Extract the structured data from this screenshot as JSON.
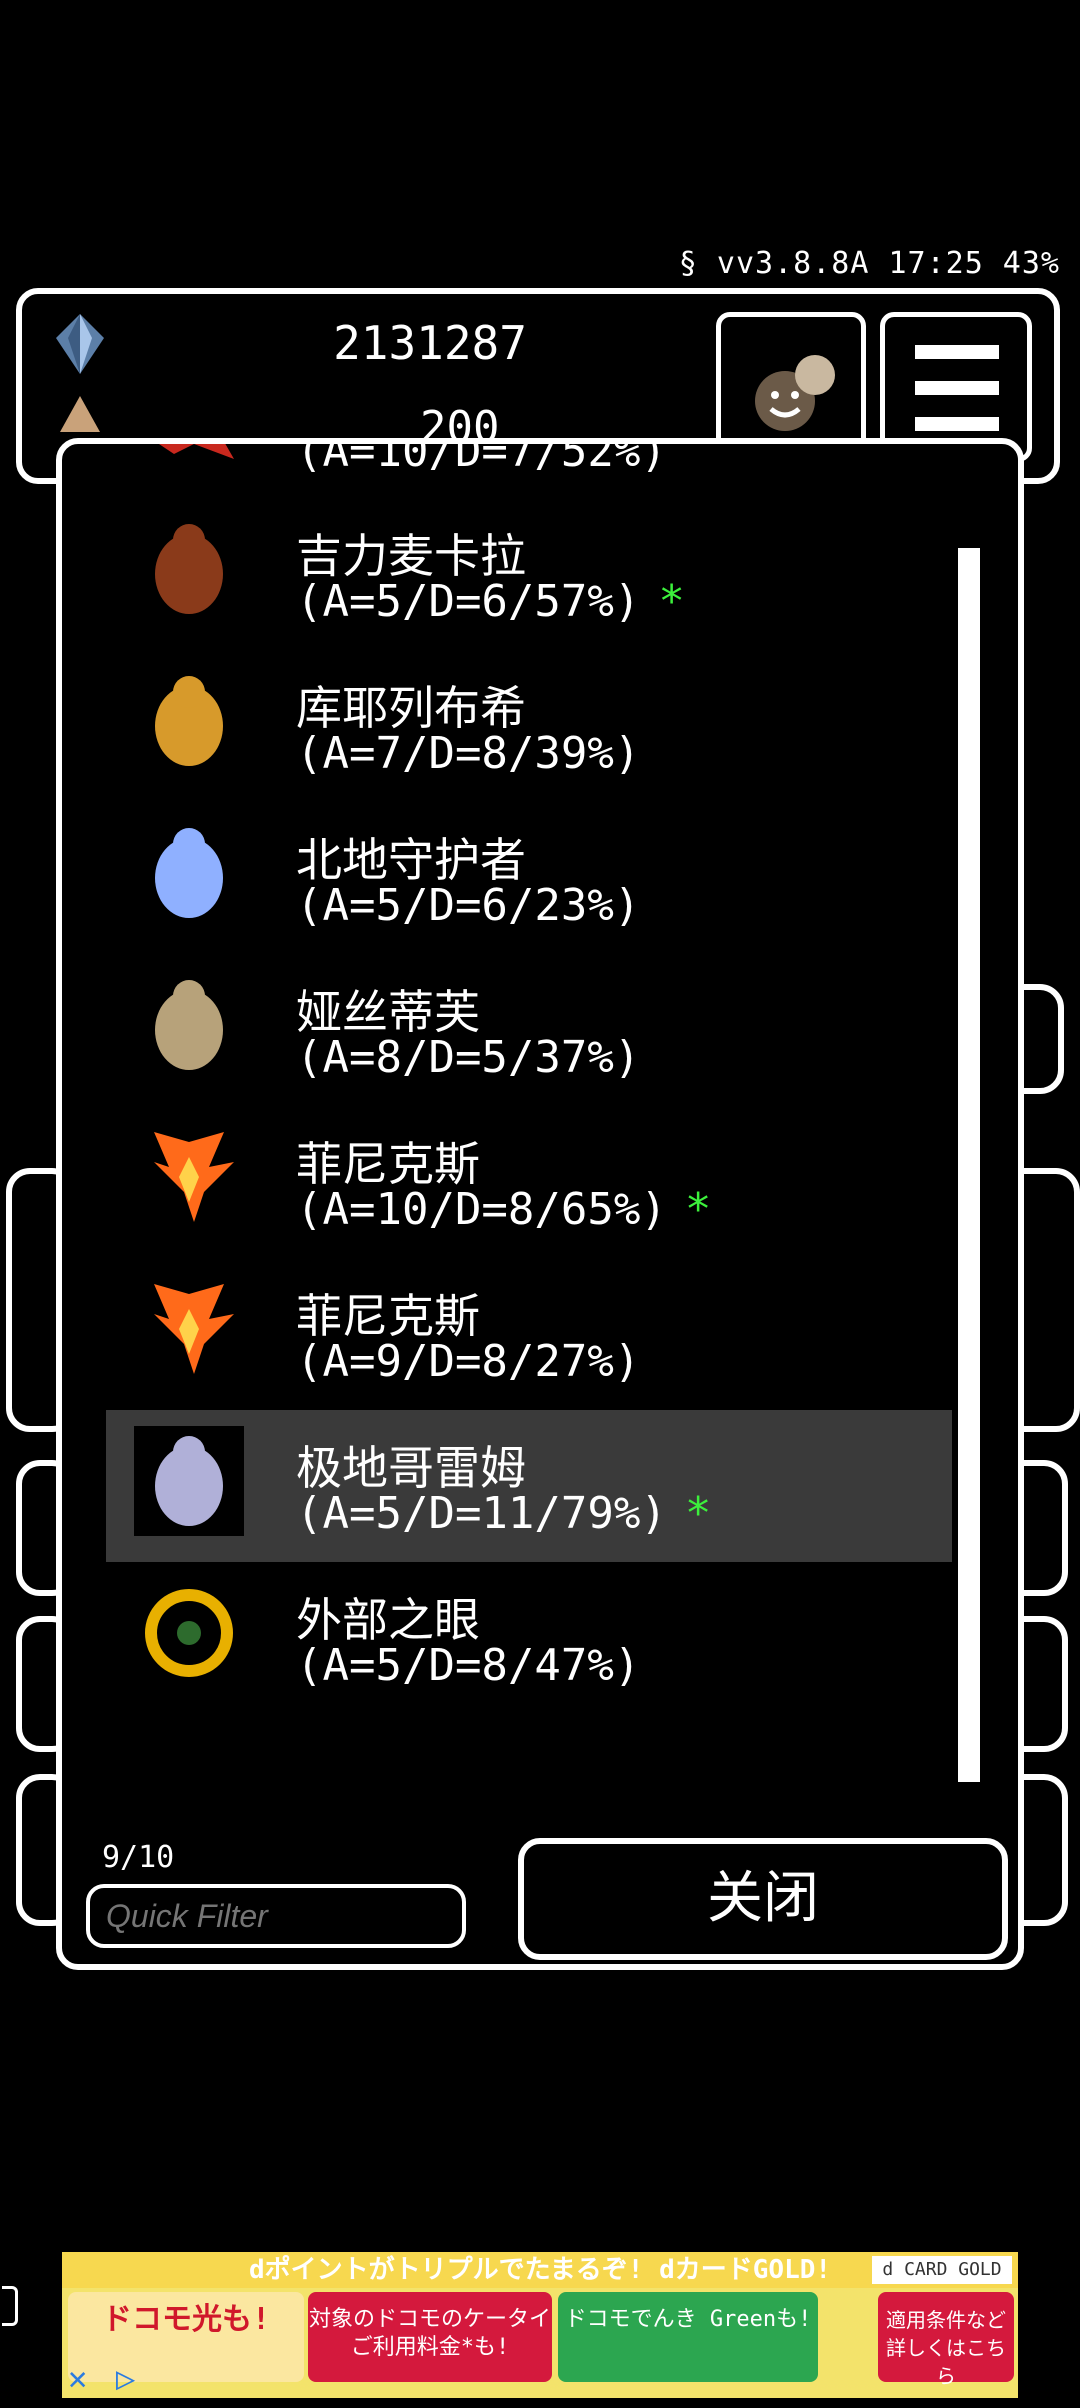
{
  "status_bar": {
    "text": "§ vv3.8.8A 17:25 43%"
  },
  "header": {
    "main_value": "2131287",
    "secondary_value": "200"
  },
  "modal": {
    "partial_row_stats": "(A=10/D=7/52%)",
    "creatures": [
      {
        "name": "吉力麦卡拉",
        "stats": "(A=5/D=6/57%)",
        "star": "*",
        "selected": false,
        "icon": "ganesha-creature-icon",
        "color": "#8a3a1a"
      },
      {
        "name": "库耶列布希",
        "stats": "(A=7/D=8/39%)",
        "star": "",
        "selected": false,
        "icon": "golden-lion-creature-icon",
        "color": "#d79a2b"
      },
      {
        "name": "北地守护者",
        "stats": "(A=5/D=6/23%)",
        "star": "",
        "selected": false,
        "icon": "ice-spirit-creature-icon",
        "color": "#8fb0ff"
      },
      {
        "name": "娅丝蒂芙",
        "stats": "(A=8/D=5/37%)",
        "star": "",
        "selected": false,
        "icon": "bone-beast-creature-icon",
        "color": "#b7a27a"
      },
      {
        "name": "菲尼克斯",
        "stats": "(A=10/D=8/65%)",
        "star": "*",
        "selected": false,
        "icon": "phoenix-creature-icon",
        "color": "#ff6a1a"
      },
      {
        "name": "菲尼克斯",
        "stats": "(A=9/D=8/27%)",
        "star": "",
        "selected": false,
        "icon": "phoenix-creature-icon",
        "color": "#ff6a1a"
      },
      {
        "name": "极地哥雷姆",
        "stats": "(A=5/D=11/79%)",
        "star": "*",
        "selected": true,
        "icon": "polar-golem-creature-icon",
        "color": "#b0b0d8"
      },
      {
        "name": "外部之眼",
        "stats": "(A=5/D=8/47%)",
        "star": "",
        "selected": false,
        "icon": "outer-eye-creature-icon",
        "color": "#e8b000"
      }
    ],
    "count_label": "9/10",
    "filter_placeholder": "Quick Filter",
    "close_label": "关闭"
  },
  "ad": {
    "headline": "dポイントがトリプルでたまるぞ! dカードGOLD!",
    "tag": "d CARD GOLD",
    "box1": "ドコモ光も!",
    "box2": "対象のドコモのケータイご利用料金*も!",
    "box3": "ドコモでんき Greenも!",
    "box4": "適用条件など詳しくはこちら",
    "close_glyph": "✕",
    "play_glyph": "▷"
  },
  "colors": {
    "accent_star": "#3cf03c",
    "selection_bg": "#3a3a3a"
  }
}
